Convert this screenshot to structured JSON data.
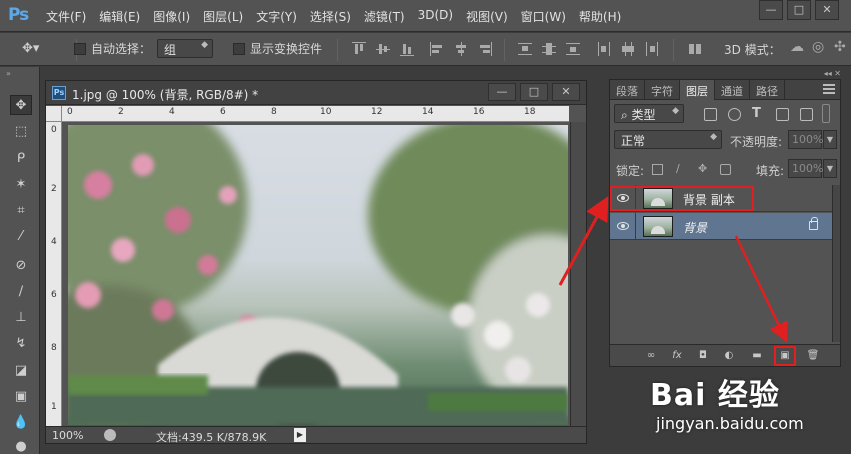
{
  "app": {
    "logo": "Ps"
  },
  "menu": [
    "文件(F)",
    "编辑(E)",
    "图像(I)",
    "图层(L)",
    "文字(Y)",
    "选择(S)",
    "滤镜(T)",
    "3D(D)",
    "视图(V)",
    "窗口(W)",
    "帮助(H)"
  ],
  "window_controls": {
    "minimize": "—",
    "maximize": "□",
    "close": "✕"
  },
  "options_bar": {
    "auto_select_label": "自动选择：",
    "auto_select_value": "组",
    "show_transform_label": "显示变换控件",
    "mode_3d_label": "3D 模式："
  },
  "document": {
    "title": "1.jpg @ 100% (背景, RGB/8#) *",
    "ps_icon": "Ps",
    "ruler_h": [
      "0",
      "2",
      "4",
      "6",
      "8",
      "10",
      "12",
      "14",
      "16",
      "18"
    ],
    "ruler_v": [
      "0",
      "2",
      "4",
      "6",
      "8",
      "1"
    ],
    "zoom": "100%",
    "doc_size": "文档:439.5 K/878.9K"
  },
  "panel": {
    "tabs": [
      "段落",
      "字符",
      "图层",
      "通道",
      "路径"
    ],
    "active_tab": "图层",
    "filter_kind": "类型",
    "blend_mode": "正常",
    "opacity_label": "不透明度:",
    "opacity_value": "100%",
    "lock_label": "锁定:",
    "fill_label": "填充:",
    "fill_value": "100%",
    "layers": [
      {
        "name": "背景 副本",
        "selected": false,
        "italic": false,
        "locked": false
      },
      {
        "name": "背景",
        "selected": true,
        "italic": true,
        "locked": true
      }
    ],
    "footer_icons": [
      "link-icon",
      "fx-icon",
      "mask-icon",
      "adjustment-icon",
      "folder-icon",
      "new-layer-icon",
      "trash-icon"
    ],
    "footer_glyphs": [
      "∞",
      "fx",
      "◘",
      "◐",
      "▬",
      "▣",
      "🗑"
    ]
  },
  "colors": {
    "annotation": "#e02020",
    "selected_layer": "#5f7590"
  },
  "watermark": {
    "brand": "Bai 经验",
    "url": "jingyan.baidu.com"
  }
}
